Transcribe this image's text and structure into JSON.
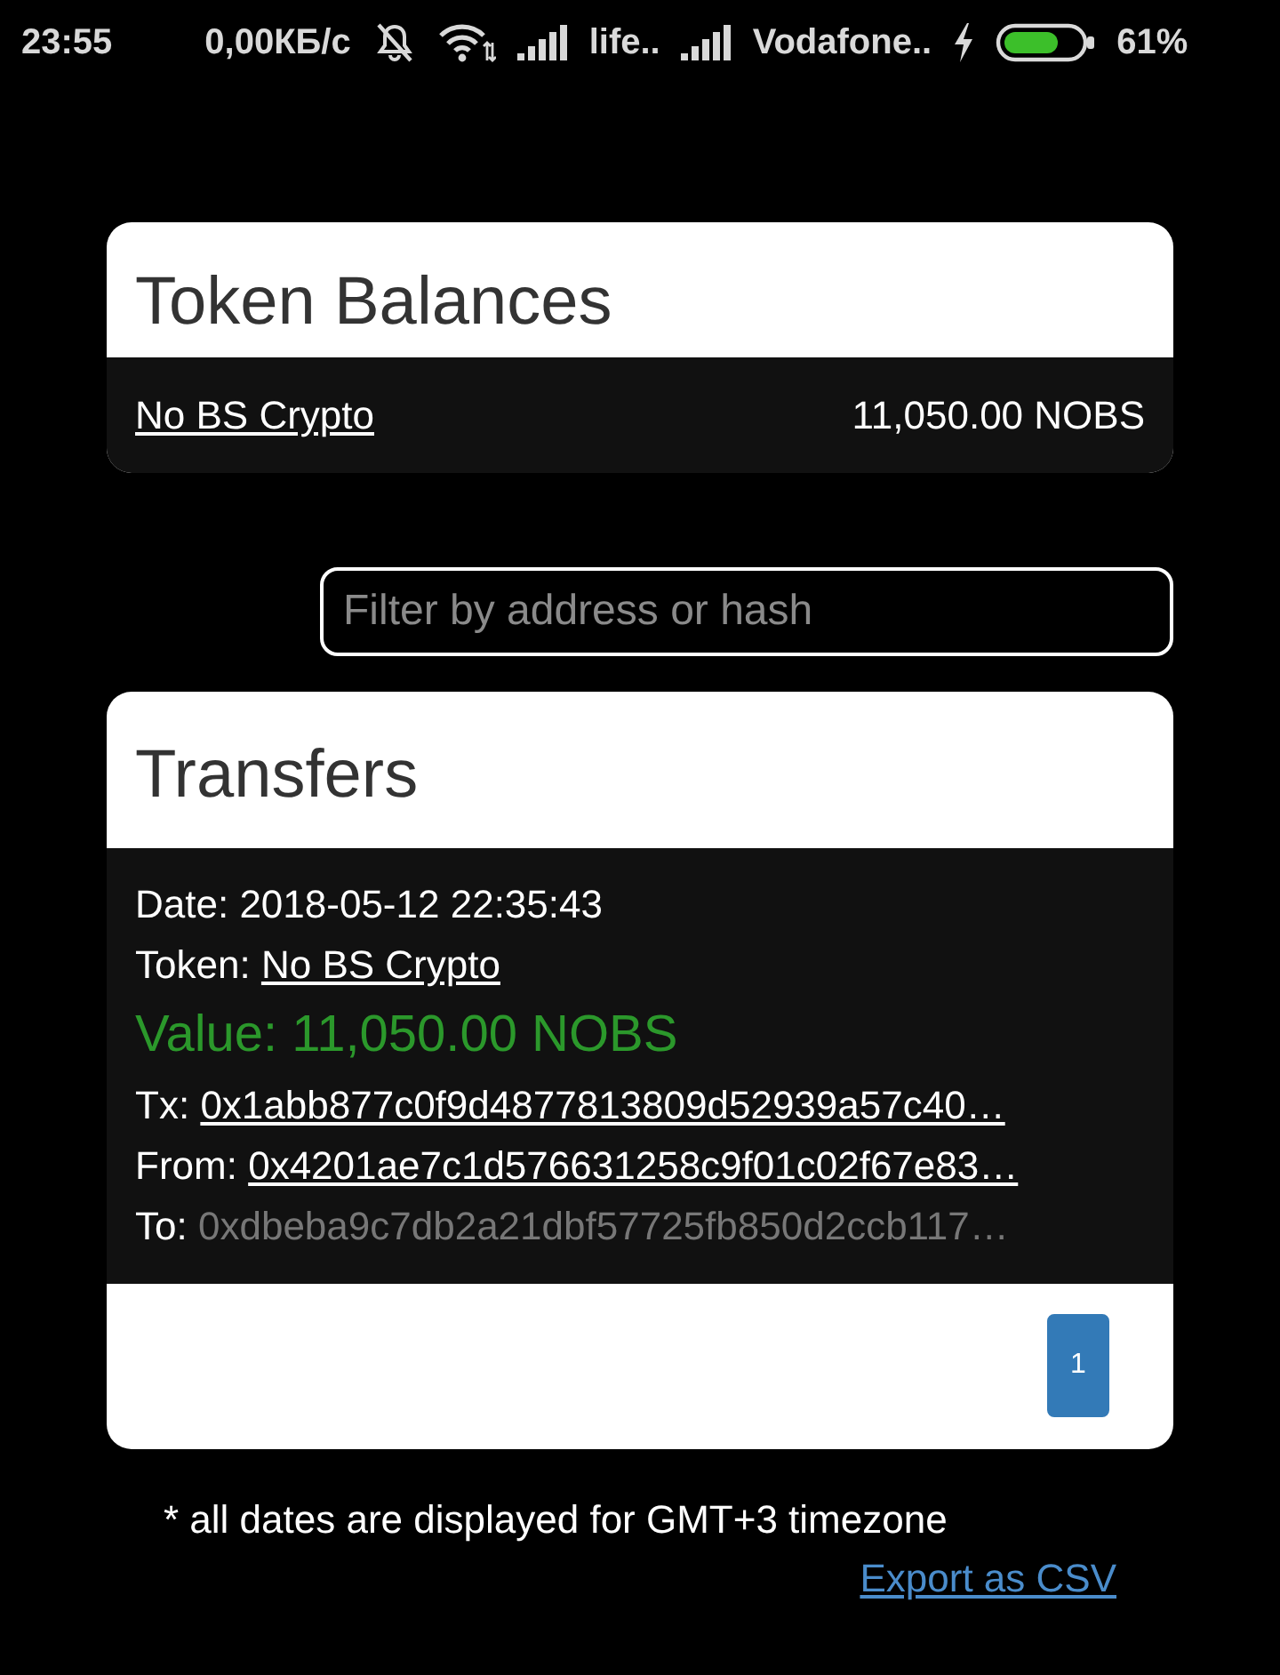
{
  "status_bar": {
    "time": "23:55",
    "network_speed": "0,00КБ/с",
    "carriers": [
      "life..",
      "Vodafone.."
    ],
    "battery_percent": "61%"
  },
  "token_balances": {
    "title": "Token Balances",
    "rows": [
      {
        "token": "No BS Crypto",
        "balance": "11,050.00 NOBS"
      }
    ]
  },
  "filter": {
    "placeholder": "Filter by address or hash"
  },
  "transfers": {
    "title": "Transfers",
    "items": [
      {
        "date": "Date: 2018-05-12 22:35:43",
        "token": {
          "label": "Token:",
          "link": "No BS Crypto"
        },
        "value": "Value: 11,050.00 NOBS",
        "tx": {
          "label": "Tx:",
          "link": "0x1abb877c0f9d4877813809d52939a57c40…"
        },
        "from": {
          "label": "From:",
          "link": "0x4201ae7c1d576631258c9f01c02f67e83…"
        },
        "to": {
          "label": "To:",
          "address": "0xdbeba9c7db2a21dbf57725fb850d2ccb117…"
        }
      }
    ],
    "pages": [
      {
        "label": "1",
        "selected": true
      }
    ]
  },
  "footnote": "* all dates are displayed for GMT+3 timezone",
  "export_link": "Export as CSV"
}
